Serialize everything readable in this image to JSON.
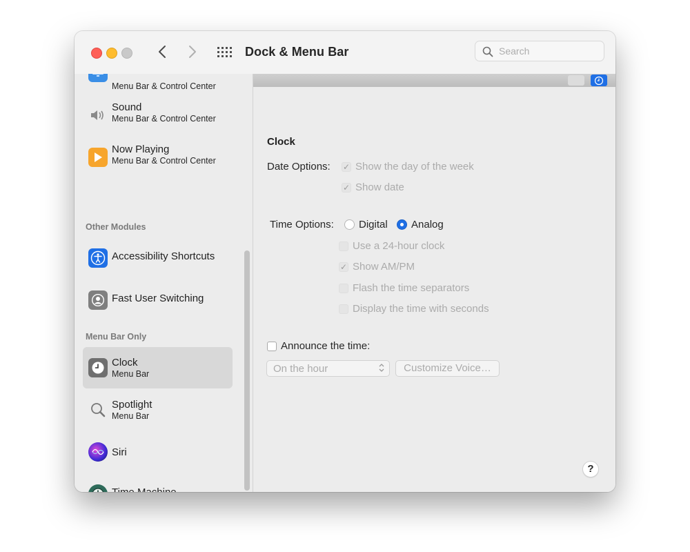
{
  "window": {
    "title": "Dock & Menu Bar"
  },
  "search": {
    "placeholder": "Search",
    "value": ""
  },
  "sidebar": {
    "partial_item": {
      "subtitle": "Menu Bar & Control Center",
      "icon": "display-icon"
    },
    "items": [
      {
        "title": "Sound",
        "subtitle": "Menu Bar & Control Center",
        "icon": "speaker-icon"
      },
      {
        "title": "Now Playing",
        "subtitle": "Menu Bar & Control Center",
        "icon": "play-icon"
      },
      {
        "title": "Accessibility Shortcuts",
        "icon": "accessibility-icon"
      },
      {
        "title": "Fast User Switching",
        "icon": "user-switch-icon"
      },
      {
        "title": "Clock",
        "subtitle": "Menu Bar",
        "icon": "clock-icon",
        "selected": true
      },
      {
        "title": "Spotlight",
        "subtitle": "Menu Bar",
        "icon": "magnifier-icon"
      },
      {
        "title": "Siri",
        "icon": "siri-icon"
      },
      {
        "title": "Time Machine",
        "icon": "time-machine-icon"
      }
    ],
    "sections": {
      "other_modules": "Other Modules",
      "menu_bar_only": "Menu Bar Only"
    }
  },
  "clock": {
    "heading": "Clock",
    "date_options_label": "Date Options:",
    "date_options": [
      {
        "label": "Show the day of the week",
        "checked": true,
        "enabled": false
      },
      {
        "label": "Show date",
        "checked": true,
        "enabled": false
      }
    ],
    "time_options_label": "Time Options:",
    "time_style": {
      "options": [
        "Digital",
        "Analog"
      ],
      "selected": "Analog"
    },
    "time_options": [
      {
        "label": "Use a 24-hour clock",
        "checked": false,
        "enabled": false
      },
      {
        "label": "Show AM/PM",
        "checked": true,
        "enabled": false
      },
      {
        "label": "Flash the time separators",
        "checked": false,
        "enabled": false
      },
      {
        "label": "Display the time with seconds",
        "checked": false,
        "enabled": false
      }
    ],
    "announce": {
      "label": "Announce the time:",
      "checked": false,
      "interval": "On the hour",
      "customize_voice": "Customize Voice…"
    }
  },
  "help": {
    "label": "?"
  },
  "colors": {
    "accent": "#1f6fe5",
    "close": "#fe5f57",
    "minimize": "#febc2e",
    "zoom_inactive": "#c9c9c9"
  }
}
